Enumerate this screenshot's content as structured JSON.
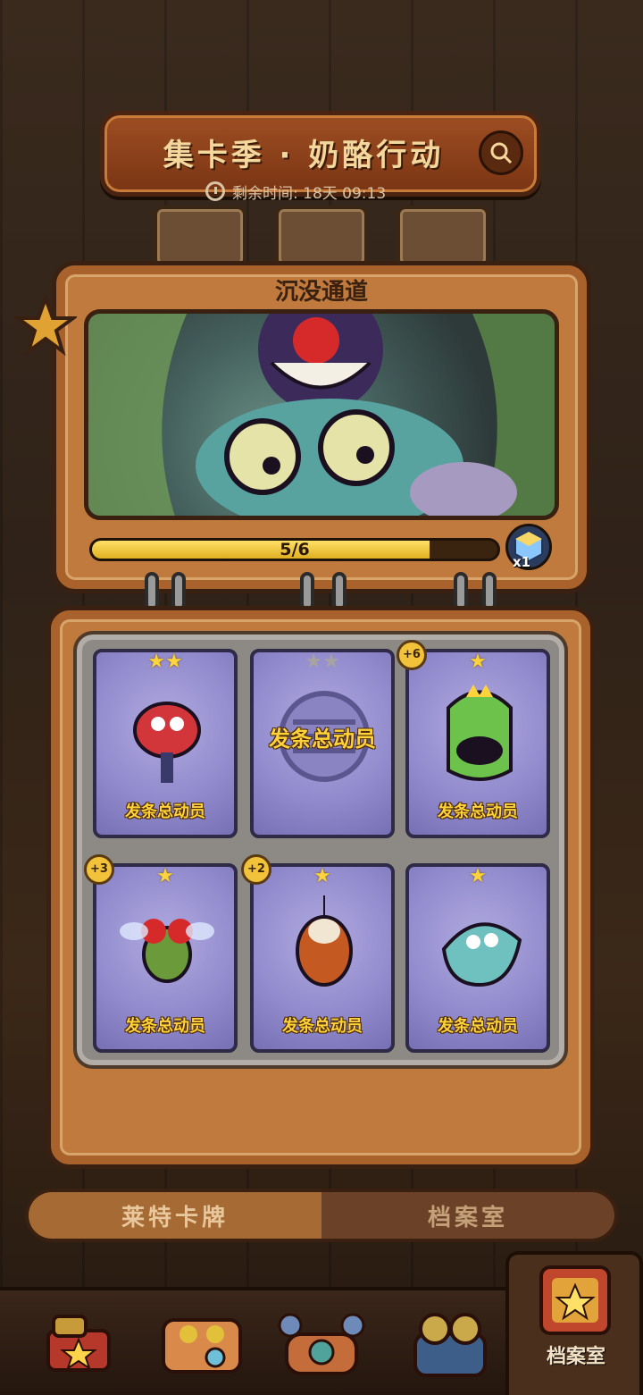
{
  "header": {
    "title": "集卡季 · 奶酪行动",
    "timer_label": "剩余时间: 18天 09:13"
  },
  "album": {
    "chapter_title": "沉没通道",
    "progress": {
      "text": "5/6",
      "fraction": 0.8333
    },
    "reward_count": "x1"
  },
  "cards": [
    {
      "stars": "★★",
      "label": "发条总动员",
      "plus": "",
      "collected": true,
      "theme": "robot-rat"
    },
    {
      "stars": "★★",
      "label": "发条总动员",
      "plus": "",
      "collected": false,
      "theme": "empty-slot"
    },
    {
      "stars": "★",
      "label": "发条总动员",
      "plus": "+6",
      "collected": true,
      "theme": "slime-king"
    },
    {
      "stars": "★",
      "label": "发条总动员",
      "plus": "+3",
      "collected": true,
      "theme": "fly"
    },
    {
      "stars": "★",
      "label": "发条总动员",
      "plus": "+2",
      "collected": true,
      "theme": "spider-rat"
    },
    {
      "stars": "★",
      "label": "发条总动员",
      "plus": "",
      "collected": true,
      "theme": "ghost-rat"
    }
  ],
  "tabs": {
    "left_label": "莱特卡牌",
    "right_label": "档案室"
  },
  "nav": {
    "archive_label": "档案室"
  },
  "colors": {
    "accent": "#ffd23a",
    "panel": "#c07a3e",
    "card_bg": "#9089cc"
  }
}
